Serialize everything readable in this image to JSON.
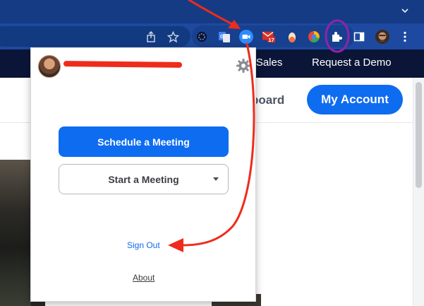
{
  "browser": {
    "extension_badge": "17",
    "icons": [
      "share-icon",
      "star-icon",
      "extension-icon",
      "google-translate-icon",
      "zoom-extension-icon",
      "gmail-icon",
      "extension-icon",
      "color-wheel-icon",
      "puzzle-icon",
      "sidebar-icon",
      "avatar",
      "kebab-menu-icon"
    ]
  },
  "site": {
    "nav": {
      "contact_sales": "ct Sales",
      "request_demo": "Request a Demo"
    },
    "header": {
      "board_link": "board",
      "my_account": "My Account"
    }
  },
  "popup": {
    "schedule_button": "Schedule a Meeting",
    "start_button": "Start a Meeting",
    "sign_out": "Sign Out",
    "about": "About"
  },
  "colors": {
    "zoom_blue": "#0e6cf0",
    "annotation_red": "#ef2b1b",
    "annotation_purple": "#8e24aa"
  }
}
